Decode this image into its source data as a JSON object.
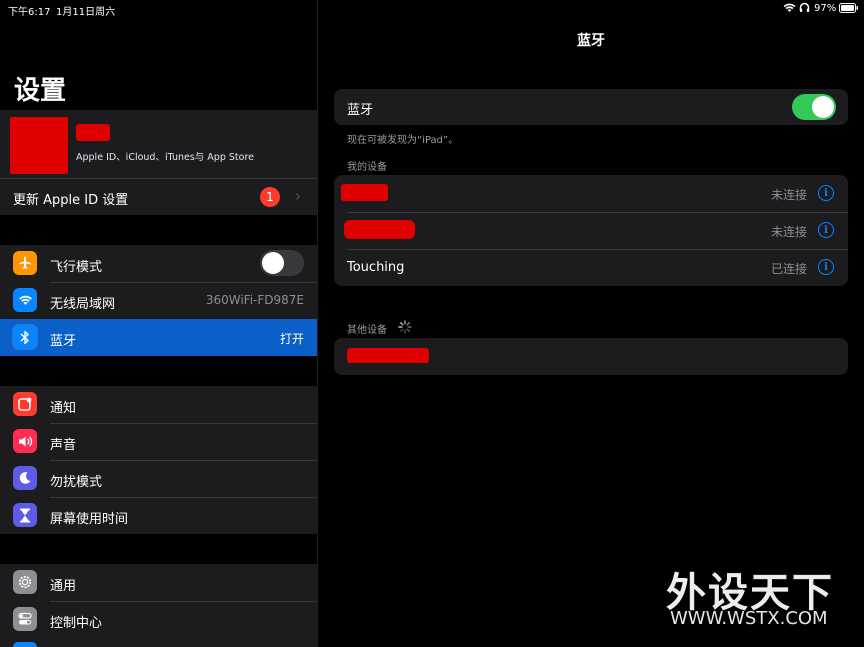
{
  "status_bar": {
    "time": "下午6:17",
    "date": "1月11日周六",
    "battery": "97%"
  },
  "sidebar": {
    "title": "设置",
    "profile": {
      "subtitle": "Apple ID、iCloud、iTunes与 App Store"
    },
    "update": {
      "label": "更新 Apple ID 设置",
      "badge": "1"
    },
    "group1": [
      {
        "label": "飞行模式",
        "icon": "airplane-icon",
        "color": "#ff9500",
        "value": ""
      },
      {
        "label": "无线局域网",
        "icon": "wifi-icon",
        "color": "#0a84ff",
        "value": "360WiFi-FD987E"
      },
      {
        "label": "蓝牙",
        "icon": "bluetooth-icon",
        "color": "#0a84ff",
        "value": "打开"
      }
    ],
    "group2": [
      {
        "label": "通知",
        "icon": "notifications-icon",
        "color": "#ff3b30"
      },
      {
        "label": "声音",
        "icon": "sound-icon",
        "color": "#ff2d55"
      },
      {
        "label": "勿扰模式",
        "icon": "moon-icon",
        "color": "#5e5ce6"
      },
      {
        "label": "屏幕使用时间",
        "icon": "hourglass-icon",
        "color": "#5e5ce6"
      }
    ],
    "group3": [
      {
        "label": "通用",
        "icon": "gear-icon",
        "color": "#8e8e93"
      },
      {
        "label": "控制中心",
        "icon": "switches-icon",
        "color": "#8e8e93"
      }
    ]
  },
  "detail": {
    "nav_title": "蓝牙",
    "bluetooth_row": {
      "label": "蓝牙",
      "on": true
    },
    "discoverable_note": "现在可被发现为“iPad”。",
    "my_devices_header": "我的设备",
    "my_devices": [
      {
        "name": "",
        "status": "未连接"
      },
      {
        "name": "",
        "status": "未连接"
      },
      {
        "name": "Touching",
        "status": "已连接"
      }
    ],
    "other_devices_header": "其他设备"
  },
  "watermark": {
    "title": "外设天下",
    "url": "WWW.WSTX.COM"
  },
  "colors": {
    "accent": "#0a84ff",
    "toggle_on": "#34c759",
    "selected": "#0a60c8"
  }
}
